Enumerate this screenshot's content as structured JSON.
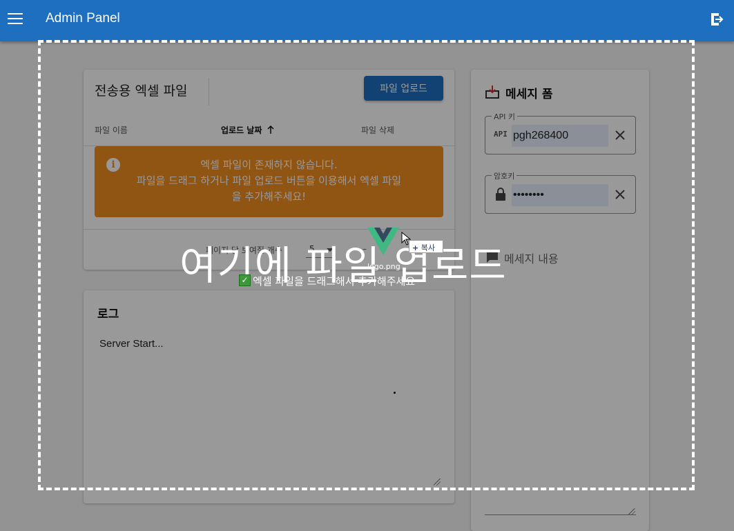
{
  "header": {
    "title": "Admin Panel"
  },
  "files": {
    "title": "전송용 엑셀 파일",
    "upload_label": "파일 업로드",
    "columns": [
      "파일 이름",
      "업로드 날짜",
      "파일 삭제"
    ],
    "alert": [
      "엑셀 파일이 존재하지 않습니다.",
      "파일을 드래그 하거나 파일 업로드 버튼을 이용해서 엑셀 파일",
      "을 추가해주세요!"
    ],
    "per_page_label": "페이지 당 보여질 개수",
    "per_page_value": "5",
    "page_range": "–"
  },
  "log": {
    "title": "로그",
    "content": "Server Start..."
  },
  "message_form": {
    "title": "메세지 폼",
    "api_label": "API 키",
    "api_prefix": "API",
    "api_value": "pgh268400",
    "password_label": "암호키",
    "password_value": "••••••••",
    "content_label": "메세지 내용"
  },
  "dropzone": {
    "text": "여기에 파일 업로드",
    "drag_hint": "엑셀 파일을 드래그해서 추가해주세요",
    "ghost_label": "logo.png",
    "copy_label": "복사"
  },
  "colors": {
    "primary": "#1e6fc0",
    "alert": "#f08c20",
    "input_fill": "#e8f0fe"
  }
}
